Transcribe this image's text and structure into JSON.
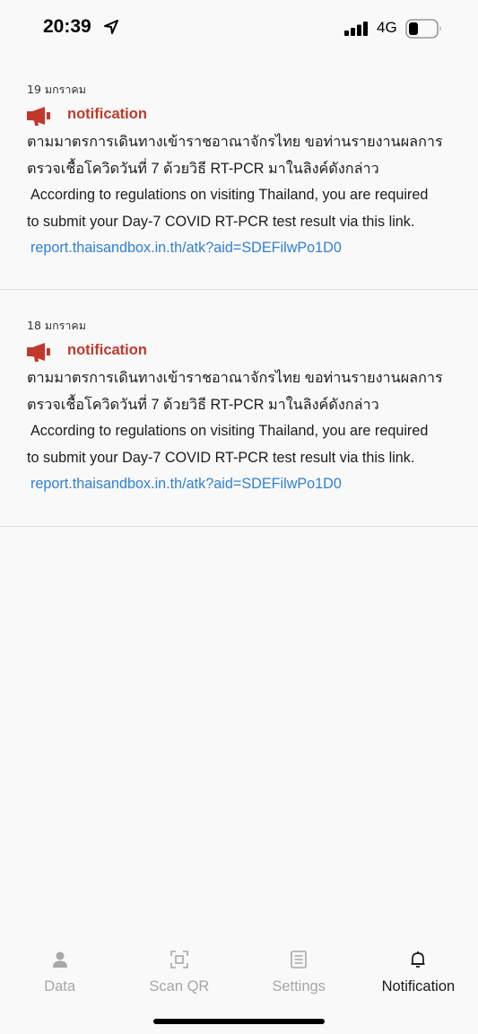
{
  "status_bar": {
    "time": "20:39",
    "network": "4G",
    "icons": [
      "location-arrow-icon",
      "signal-bars-icon",
      "battery-icon"
    ]
  },
  "notifications": [
    {
      "date": "19 มกราคม",
      "title": "notification",
      "icon": "megaphone-icon",
      "thai_line1": "ตามมาตรการเดินทางเข้าราชอาณาจักรไทย ขอท่านรายงานผลการ",
      "thai_line2": "ตรวจเชื้อโควิดวันที่ 7 ด้วยวิธี RT-PCR มาในลิงค์ดังกล่าว",
      "en_line1": "According to regulations on visiting Thailand, you are required",
      "en_line2": "to submit your Day-7 COVID RT-PCR test result via this link.",
      "link": "report.thaisandbox.in.th/atk?aid=SDEFilwPo1D0"
    },
    {
      "date": "18 มกราคม",
      "title": "notification",
      "icon": "megaphone-icon",
      "thai_line1": "ตามมาตรการเดินทางเข้าราชอาณาจักรไทย ขอท่านรายงานผลการ",
      "thai_line2": "ตรวจเชื้อโควิดวันที่ 7 ด้วยวิธี RT-PCR มาในลิงค์ดังกล่าว",
      "en_line1": "According to regulations on visiting Thailand, you are required",
      "en_line2": "to submit your Day-7 COVID RT-PCR test result via this link.",
      "link": "report.thaisandbox.in.th/atk?aid=SDEFilwPo1D0"
    }
  ],
  "tabs": [
    {
      "label": "Data",
      "icon": "person-icon",
      "active": false
    },
    {
      "label": "Scan QR",
      "icon": "qr-scan-icon",
      "active": false
    },
    {
      "label": "Settings",
      "icon": "list-icon",
      "active": false
    },
    {
      "label": "Notification",
      "icon": "bell-icon",
      "active": true
    }
  ],
  "colors": {
    "accent_red": "#c0392b",
    "link_blue": "#2f80d7",
    "inactive_tab": "#a7a7a7"
  }
}
